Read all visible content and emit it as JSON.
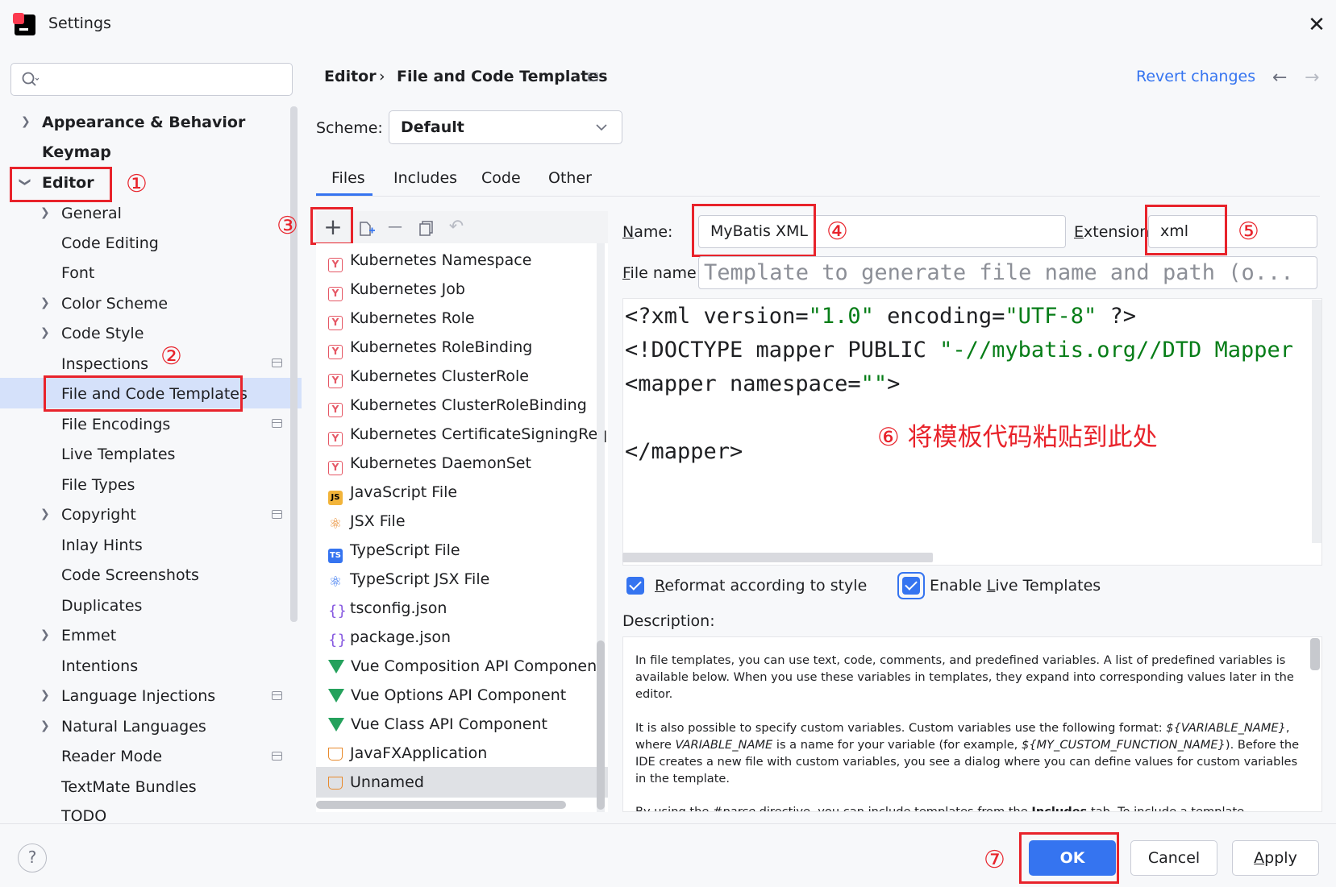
{
  "window": {
    "title": "Settings"
  },
  "search": {
    "placeholder": ""
  },
  "tree": {
    "items": [
      {
        "label": "Appearance & Behavior"
      },
      {
        "label": "Keymap"
      },
      {
        "label": "Editor"
      },
      {
        "label": "General"
      },
      {
        "label": "Code Editing"
      },
      {
        "label": "Font"
      },
      {
        "label": "Color Scheme"
      },
      {
        "label": "Code Style"
      },
      {
        "label": "Inspections"
      },
      {
        "label": "File and Code Templates"
      },
      {
        "label": "File Encodings"
      },
      {
        "label": "Live Templates"
      },
      {
        "label": "File Types"
      },
      {
        "label": "Copyright"
      },
      {
        "label": "Inlay Hints"
      },
      {
        "label": "Code Screenshots"
      },
      {
        "label": "Duplicates"
      },
      {
        "label": "Emmet"
      },
      {
        "label": "Intentions"
      },
      {
        "label": "Language Injections"
      },
      {
        "label": "Natural Languages"
      },
      {
        "label": "Reader Mode"
      },
      {
        "label": "TextMate Bundles"
      },
      {
        "label": "TODO"
      }
    ]
  },
  "annotations": {
    "n1": "①",
    "n2": "②",
    "n3": "③",
    "n4": "④",
    "n5": "⑤",
    "n6": "⑥",
    "n7": "⑦",
    "note6": "将模板代码粘贴到此处"
  },
  "header": {
    "breadcrumb_1": "Editor",
    "breadcrumb_sep": "›",
    "breadcrumb_2": "File and Code Templates",
    "revert": "Revert changes",
    "back": "←",
    "forward": "→"
  },
  "scheme": {
    "label": "Scheme:",
    "value": "Default"
  },
  "tabs": [
    {
      "label": "Files"
    },
    {
      "label": "Includes"
    },
    {
      "label": "Code"
    },
    {
      "label": "Other"
    }
  ],
  "toolbar": {
    "add": "+",
    "remove": "—",
    "undo": "↶"
  },
  "templates": [
    {
      "label": "Kubernetes Namespace",
      "icon": "Y"
    },
    {
      "label": "Kubernetes Job",
      "icon": "Y"
    },
    {
      "label": "Kubernetes Role",
      "icon": "Y"
    },
    {
      "label": "Kubernetes RoleBinding",
      "icon": "Y"
    },
    {
      "label": "Kubernetes ClusterRole",
      "icon": "Y"
    },
    {
      "label": "Kubernetes ClusterRoleBinding",
      "icon": "Y"
    },
    {
      "label": "Kubernetes CertificateSigningReques",
      "icon": "Y"
    },
    {
      "label": "Kubernetes DaemonSet",
      "icon": "Y"
    },
    {
      "label": "JavaScript File",
      "icon": "JS"
    },
    {
      "label": "JSX File",
      "icon": "⚛"
    },
    {
      "label": "TypeScript File",
      "icon": "TS"
    },
    {
      "label": "TypeScript JSX File",
      "icon": "⚛"
    },
    {
      "label": "tsconfig.json",
      "icon": "{}"
    },
    {
      "label": "package.json",
      "icon": "{}"
    },
    {
      "label": "Vue Composition API Component",
      "icon": ""
    },
    {
      "label": "Vue Options API Component",
      "icon": ""
    },
    {
      "label": "Vue Class API Component",
      "icon": ""
    },
    {
      "label": "JavaFXApplication",
      "icon": ""
    },
    {
      "label": "Unnamed",
      "icon": ""
    }
  ],
  "form": {
    "name_label_u": "N",
    "name_label_rest": "ame:",
    "name_value": "MyBatis XML",
    "ext_label_u": "E",
    "ext_label_rest": "xtension:",
    "ext_value": "xml",
    "filename_label_u": "F",
    "filename_label_rest": "ile name:",
    "filename_placeholder": "Template to generate file name and path (o..."
  },
  "code": {
    "l1a": "<?xml version=",
    "l1b": "\"1.0\"",
    "l1c": " encoding=",
    "l1d": "\"UTF-8\"",
    "l1e": " ?>",
    "l2a": "<!DOCTYPE mapper PUBLIC ",
    "l2b": "\"-//mybatis.org//DTD Mapper",
    "l3a": "<mapper namespace=",
    "l3b": "\"\"",
    "l3c": ">",
    "l5": "</mapper>"
  },
  "options": {
    "reformat_u": "R",
    "reformat_rest": "eformat according to style",
    "reformat_checked": true,
    "live_pre": "Enable ",
    "live_u": "L",
    "live_rest": "ive Templates",
    "live_checked": true
  },
  "description": {
    "label": "Description:",
    "p1": "In file templates, you can use text, code, comments, and predefined variables. A list of predefined variables is available below. When you use these variables in templates, they expand into corresponding values later in the editor.",
    "p2a": "It is also possible to specify custom variables. Custom variables use the following format: ",
    "p2b": "${VARIABLE_NAME}",
    "p2c": ", where ",
    "p2d": "VARIABLE_NAME",
    "p2e": " is a name for your variable (for example, ",
    "p2f": "${MY_CUSTOM_FUNCTION_NAME}",
    "p2g": "). Before the IDE creates a new file with custom variables, you see a dialog where you can define values for custom variables in the template.",
    "p3a": "By using the ",
    "p3b": "#parse",
    "p3c": " directive, you can include templates from the ",
    "p3d": "Includes",
    "p3e": " tab. To include a template"
  },
  "footer": {
    "help": "?",
    "ok": "OK",
    "cancel": "Cancel",
    "apply_u": "A",
    "apply_rest": "pply"
  }
}
